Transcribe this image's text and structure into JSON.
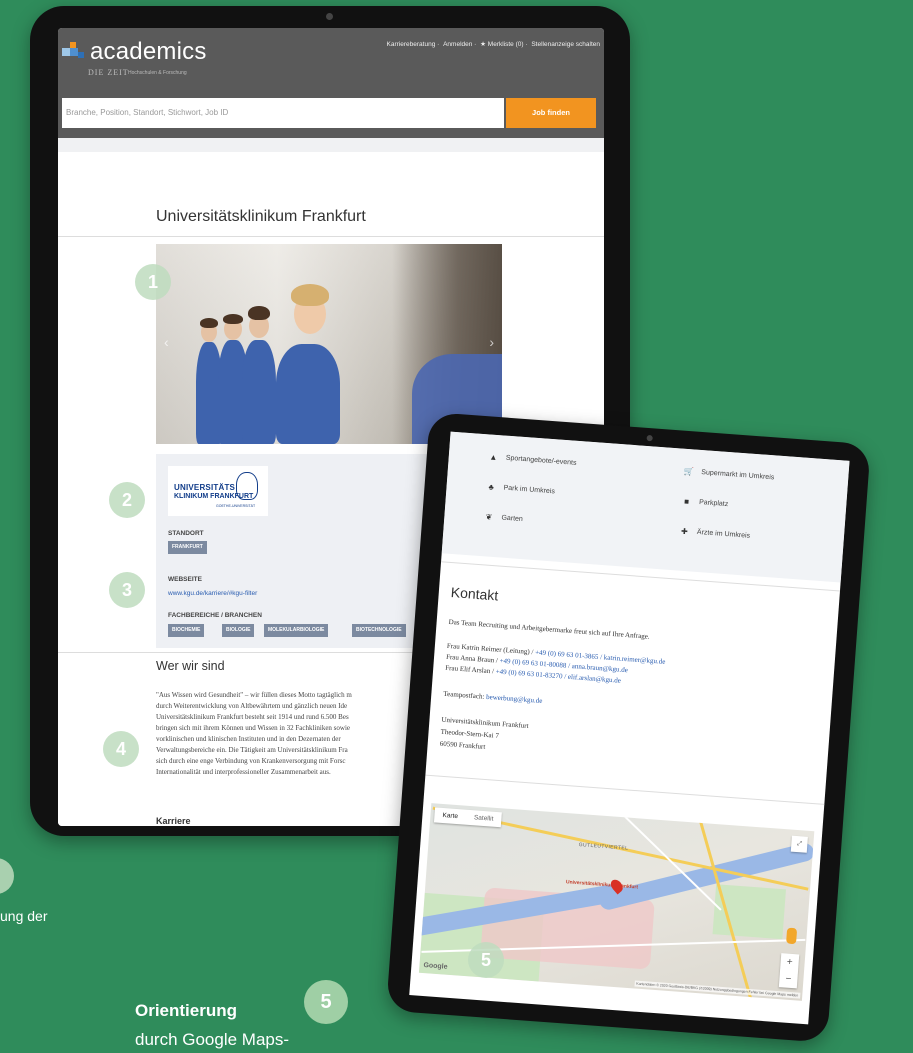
{
  "colors": {
    "background": "#2f8c5b",
    "brand_orange": "#f29420",
    "header_gray": "#5a5a5a",
    "link_blue": "#2a5db0",
    "tag_gray": "#7c8aa0"
  },
  "tablet1": {
    "logo_text": "academics",
    "logo_sub": "DIE ZEIT",
    "logo_sub2": "Hochschulen & Forschung",
    "topnav": [
      "Karriereberatung",
      "Anmelden",
      "★ Merkliste (0)",
      "Stellenanzeige schalten"
    ],
    "search": {
      "placeholder": "Branche, Position, Standort, Stichwort, Job ID",
      "button": "Job finden"
    },
    "company_title": "Universitätsklinikum Frankfurt",
    "logo_box": {
      "line1": "UNIVERSITÄTS",
      "line2": "KLINIKUM FRANKFURT",
      "line3": "GOETHE-UNIVERSITÄT"
    },
    "standort_label": "STANDORT",
    "standort_tag": "FRANKFURT",
    "webseite_label": "WEBSEITE",
    "webseite_link": "www.kgu.de/karriere/#kgu-filter",
    "fachbereiche_label": "FACHBEREICHE / BRANCHEN",
    "fachbereiche": [
      "BIOCHEMIE",
      "BIOLOGIE",
      "MOLEKULARBIOLOGIE",
      "BIOTECHNOLOGIE"
    ],
    "who_title": "Wer wir sind",
    "who_lines": [
      "\"Aus Wissen wird Gesundheit\" – wir füllen dieses Motto tagtäglich m",
      "durch Weiterentwicklung von Altbewährtem und gänzlich neuen Ide",
      "Universitätsklinikum Frankfurt besteht seit 1914 und rund 6.500 Bes",
      "bringen sich mit ihrem Können und Wissen in 32 Fachkliniken sowie",
      "vorklinischen und klinischen Instituten und in den Dezernaten der",
      "Verwaltungsbereiche ein. Die Tätigkeit am Universitätsklinikum Fra",
      "sich durch eine enge Verbindung von Krankenversorgung mit Forsc",
      "Internationalität und interprofessioneller Zusammenarbeit aus."
    ],
    "karriere_heading": "Karriere"
  },
  "tablet2": {
    "amenities": [
      {
        "icon": "sports-icon",
        "label": "Sportangebote/-events"
      },
      {
        "icon": "cart-icon",
        "label": "Supermarkt im Umkreis"
      },
      {
        "icon": "park-icon",
        "label": "Park im Umkreis"
      },
      {
        "icon": "car-icon",
        "label": "Parkplatz"
      },
      {
        "icon": "leaf-icon",
        "label": "Garten"
      },
      {
        "icon": "doctor-icon",
        "label": "Ärzte im Umkreis"
      }
    ],
    "kontakt_title": "Kontakt",
    "kontakt_intro": "Das Team Recruiting und Arbeitgebermarke freut sich auf Ihre Anfrage.",
    "contacts": [
      {
        "name": "Frau Katrin Reimer (Leitung) / ",
        "contact": "+49 (0) 69 63 01-3865 / katrin.reimer@kgu.de"
      },
      {
        "name": "Frau Anna Braun / ",
        "contact": "+49 (0) 69 63 01-80088 / anna.braun@kgu.de"
      },
      {
        "name": "Frau Elif Arslan / ",
        "contact": "+49 (0) 69 63 01-83270 / elif.arslan@kgu.de"
      }
    ],
    "teampostfach_label": "Teampostfach: ",
    "teampostfach_email": "bewerbung@kgu.de",
    "address": [
      "Universitätsklinikum Frankfurt",
      "Theodor-Stern-Kai 7",
      "60590 Frankfurt"
    ],
    "map": {
      "tab_map": "Karte",
      "tab_sat": "Satellit",
      "district": "GUTLEUTVIERTEL",
      "pin_label": "Universitätsklinikum Frankfurt",
      "google": "Google",
      "footer": "Kartendaten © 2020 GeoBasis-DE/BKG (©2009)  Nutzungsbedingungen  Fehler bei Google Maps melden",
      "zoom_in": "+",
      "zoom_out": "−"
    }
  },
  "badges": {
    "b1": "1",
    "b2": "2",
    "b3": "3",
    "b4": "4",
    "b5": "5",
    "b5_big": "5"
  },
  "captions": {
    "left_fragment": "ung der",
    "orientierung_title": "Orientierung",
    "orientierung_sub": "durch Google Maps-"
  }
}
